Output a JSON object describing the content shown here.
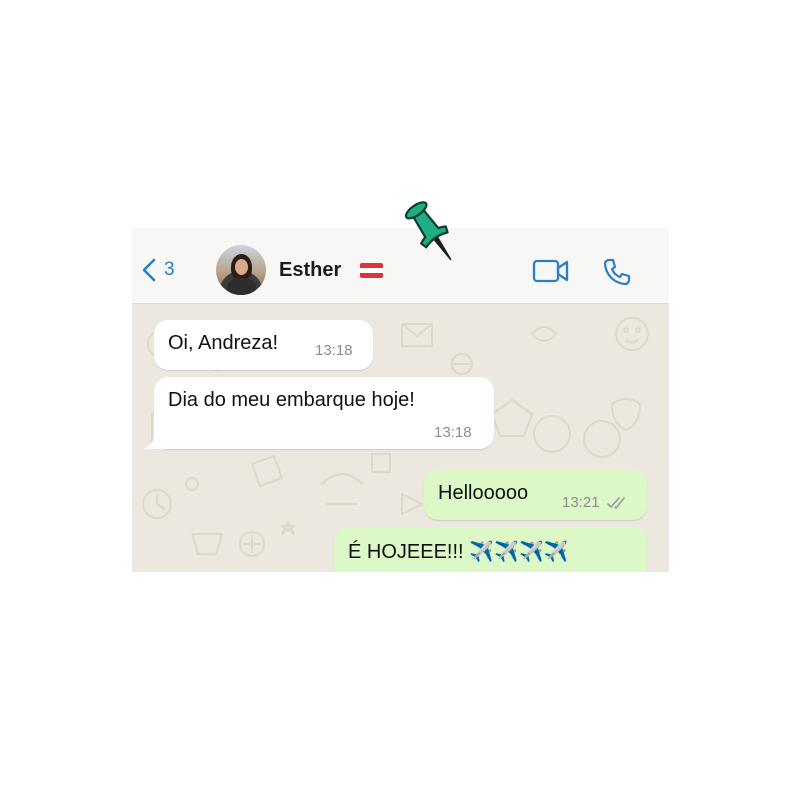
{
  "header": {
    "back_count": "3",
    "contact_name": "Esther"
  },
  "colors": {
    "accent": "#2a7ec3",
    "incoming_bubble": "#ffffff",
    "outgoing_bubble": "#dcf8c6",
    "chat_background": "#ece7df",
    "pin": "#1fae84"
  },
  "messages": [
    {
      "direction": "incoming",
      "text": "Oi, Andreza!",
      "time": "13:18"
    },
    {
      "direction": "incoming",
      "text": "Dia do meu embarque hoje!",
      "time": "13:18"
    },
    {
      "direction": "outgoing",
      "text": "Hellooooo",
      "time": "13:21",
      "status": "delivered-double-check"
    },
    {
      "direction": "outgoing",
      "text": "É HOJEEE!!! ✈️✈️✈️✈️"
    }
  ],
  "icons": {
    "back": "chevron-left-icon",
    "video": "video-camera-icon",
    "call": "phone-icon",
    "flag": "austria-flag-icon",
    "pin": "pushpin-icon"
  }
}
